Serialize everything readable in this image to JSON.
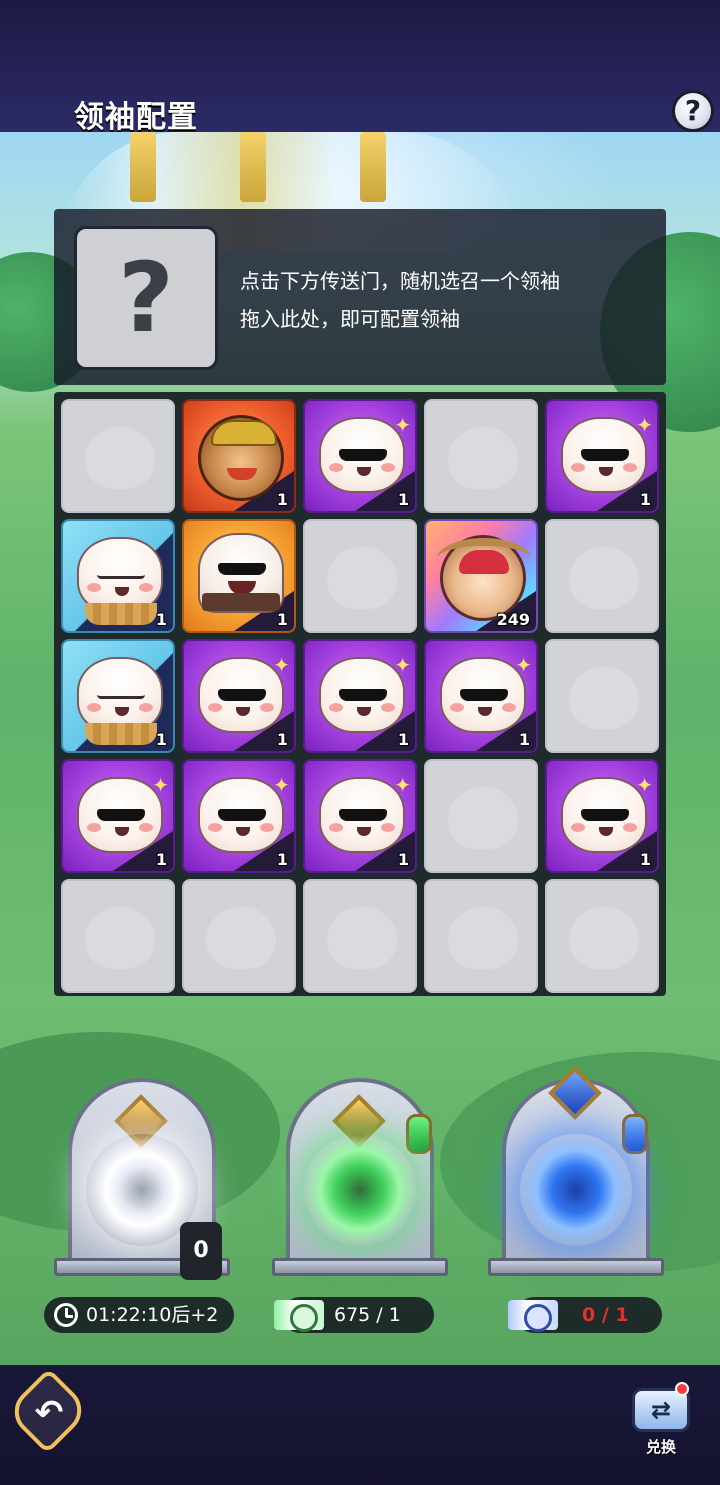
{
  "header": {
    "title": "领袖配置",
    "help_label": "?"
  },
  "leader_panel": {
    "slot_placeholder": "?",
    "hint_line1": "点击下方传送门，随机选召一个领袖",
    "hint_line2": "拖入此处，即可配置领袖"
  },
  "grid": {
    "rows": [
      [
        {
          "type": "empty",
          "count": ""
        },
        {
          "type": "hero-monkey",
          "rarity": "red",
          "count": "1"
        },
        {
          "type": "bun",
          "rarity": "purple",
          "count": "1"
        },
        {
          "type": "empty",
          "count": ""
        },
        {
          "type": "bun",
          "rarity": "purple",
          "count": "1"
        }
      ],
      [
        {
          "type": "bun-cupcake",
          "rarity": "blue",
          "count": "1"
        },
        {
          "type": "hero-bun-box",
          "rarity": "orange",
          "count": "1"
        },
        {
          "type": "empty",
          "count": ""
        },
        {
          "type": "hero-dragon",
          "rarity": "rainbow",
          "count": "249"
        },
        {
          "type": "empty",
          "count": ""
        }
      ],
      [
        {
          "type": "bun-cupcake",
          "rarity": "blue",
          "count": "1"
        },
        {
          "type": "bun",
          "rarity": "purple",
          "count": "1"
        },
        {
          "type": "bun",
          "rarity": "purple",
          "count": "1"
        },
        {
          "type": "bun",
          "rarity": "purple",
          "count": "1"
        },
        {
          "type": "empty",
          "count": ""
        }
      ],
      [
        {
          "type": "bun",
          "rarity": "purple",
          "count": "1"
        },
        {
          "type": "bun",
          "rarity": "purple",
          "count": "1"
        },
        {
          "type": "bun",
          "rarity": "purple",
          "count": "1"
        },
        {
          "type": "empty",
          "count": ""
        },
        {
          "type": "bun",
          "rarity": "purple",
          "count": "1"
        }
      ],
      [
        {
          "type": "empty",
          "count": ""
        },
        {
          "type": "empty",
          "count": ""
        },
        {
          "type": "empty",
          "count": ""
        },
        {
          "type": "empty",
          "count": ""
        },
        {
          "type": "empty",
          "count": ""
        }
      ]
    ]
  },
  "portals": {
    "white": {
      "count_badge": "0",
      "timer_text": "01:22:10后+2"
    },
    "green": {
      "ticket_text": "675 / 1"
    },
    "blue": {
      "ticket_text": "0 / 1",
      "ticket_color": "#e23030"
    }
  },
  "footer": {
    "exchange_label": "兑换",
    "exchange_icon": "swap-arrows-icon",
    "back_icon": "back-arrow-icon"
  },
  "colors": {
    "rarity_purple": "#a442de",
    "rarity_blue": "#66c7ea",
    "rarity_orange": "#f6a233",
    "rarity_red": "#ec5a2a",
    "empty_slot": "#d2d3d7"
  }
}
